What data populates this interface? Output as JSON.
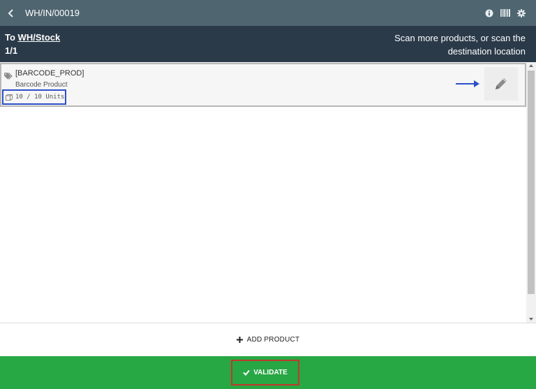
{
  "header": {
    "title": "WH/IN/00019",
    "icons": [
      "back-icon",
      "info-icon",
      "barcode-icon",
      "gear-icon"
    ]
  },
  "info": {
    "to_prefix": "To",
    "location": "WH/Stock",
    "count": "1/1",
    "hint": "Scan more products, or scan the destination location"
  },
  "lines": [
    {
      "code": "[BARCODE_PROD]",
      "name": "Barcode Product",
      "quantity": "10 / 10 Units"
    }
  ],
  "footer": {
    "add_label": "ADD PRODUCT",
    "validate_label": "VALIDATE"
  },
  "colors": {
    "topbar": "#4f6570",
    "infobar": "#2a3a49",
    "validate": "#28a745",
    "highlight_blue": "#2c4fc8",
    "highlight_red": "#c0392b"
  }
}
